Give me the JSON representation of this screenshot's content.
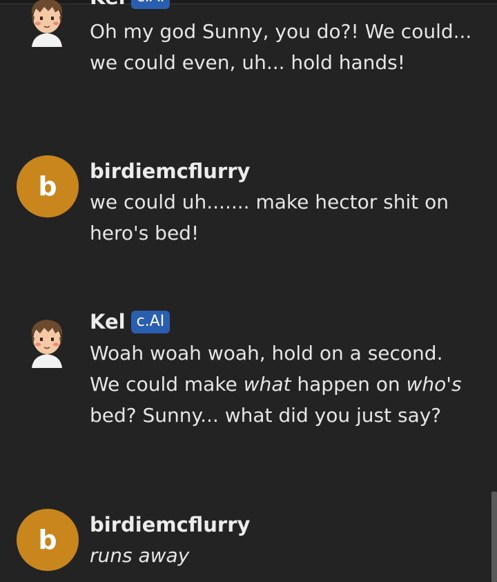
{
  "messages": [
    {
      "author": "Kel",
      "badge": "c.AI",
      "text_parts": [
        "Oh my god Sunny, you do?! We could... we could even, uh... hold hands!"
      ]
    },
    {
      "author": "birdiemcflurry",
      "avatar_letter": "b",
      "text_parts": [
        "we could uh....... make hector shit on hero's bed!"
      ]
    },
    {
      "author": "Kel",
      "badge": "c.AI",
      "text_parts": [
        "Woah woah woah, hold on a second. We could make ",
        "what",
        " happen on ",
        "who's",
        " bed? Sunny... what did you just say?"
      ]
    },
    {
      "author": "birdiemcflurry",
      "avatar_letter": "b",
      "text_parts": [
        "runs away"
      ]
    }
  ],
  "colors": {
    "background": "#232323",
    "avatar_letter_bg": "#c8861c",
    "badge_bg": "#2a5fb0"
  }
}
